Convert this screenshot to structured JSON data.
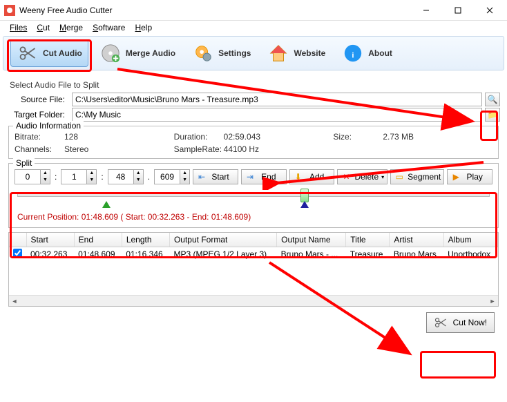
{
  "window": {
    "title": "Weeny Free Audio Cutter"
  },
  "menu": {
    "files": "Files",
    "cut": "Cut",
    "merge": "Merge",
    "software": "Software",
    "help": "Help"
  },
  "toolbar": {
    "cut_audio": "Cut Audio",
    "merge_audio": "Merge Audio",
    "settings": "Settings",
    "website": "Website",
    "about": "About"
  },
  "select_section": {
    "title": "Select Audio File to Split",
    "source_label": "Source File:",
    "source_value": "C:\\Users\\editor\\Music\\Bruno Mars - Treasure.mp3",
    "target_label": "Target Folder:",
    "target_value": "C:\\My Music"
  },
  "audio_info": {
    "title": "Audio Information",
    "bitrate_k": "Bitrate:",
    "bitrate_v": "128",
    "channels_k": "Channels:",
    "channels_v": "Stereo",
    "duration_k": "Duration:",
    "duration_v": "02:59.043",
    "samplerate_k": "SampleRate:",
    "samplerate_v": "44100 Hz",
    "size_k": "Size:",
    "size_v": "2.73 MB"
  },
  "split": {
    "title": "Split",
    "min": "0",
    "sec1": "1",
    "sec2": "48",
    "ms": "609",
    "start": "Start",
    "end": "End",
    "add": "Add",
    "delete": "Delete",
    "segment": "Segment",
    "play": "Play",
    "curpos": "Current Position: 01:48.609 ( Start: 00:32.263 - End: 01:48.609)"
  },
  "table": {
    "headers": {
      "start": "Start",
      "end": "End",
      "length": "Length",
      "format": "Output Format",
      "name": "Output Name",
      "title": "Title",
      "artist": "Artist",
      "album": "Album"
    },
    "row": {
      "start": "00:32.263",
      "end": "01:48.609",
      "length": "01:16.346",
      "format": "MP3 (MPEG 1/2 Layer 3)",
      "name": "Bruno Mars - ...",
      "title": "Treasure",
      "artist": "Bruno Mars",
      "album": "Unorthodox"
    }
  },
  "cutnow": {
    "label": "Cut Now!"
  }
}
